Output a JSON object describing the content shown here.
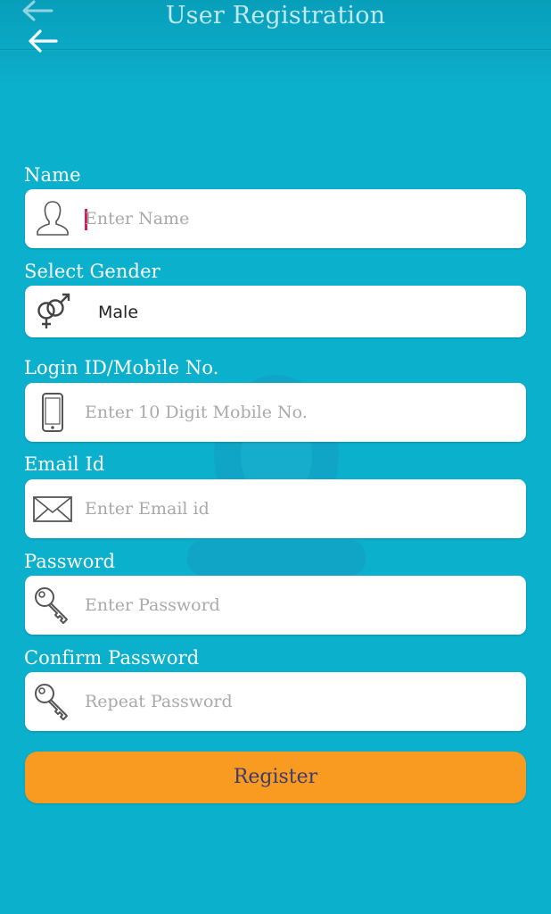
{
  "app_bar": {
    "title": "User Registration",
    "back_icon": "arrow-left-icon"
  },
  "form": {
    "name": {
      "label": "Name",
      "placeholder": "Enter Name",
      "icon": "user-icon"
    },
    "gender": {
      "label": "Select Gender",
      "selected": "Male",
      "icon": "gender-icon"
    },
    "login_id": {
      "label": "Login ID/Mobile No.",
      "placeholder": "Enter 10 Digit Mobile No.",
      "icon": "mobile-phone-icon"
    },
    "email": {
      "label": "Email Id",
      "placeholder": "Enter Email id",
      "icon": "envelope-icon"
    },
    "password": {
      "label": "Password",
      "placeholder": "Enter Password",
      "icon": "key-icon"
    },
    "confirm_password": {
      "label": "Confirm Password",
      "placeholder": "Repeat Password",
      "icon": "key-icon"
    },
    "register_label": "Register"
  },
  "colors": {
    "background": "#0bb0cd",
    "title_text": "#bfe8ef",
    "button": "#f99b20",
    "button_text": "#3d3a6e",
    "caret": "#d81b60"
  }
}
